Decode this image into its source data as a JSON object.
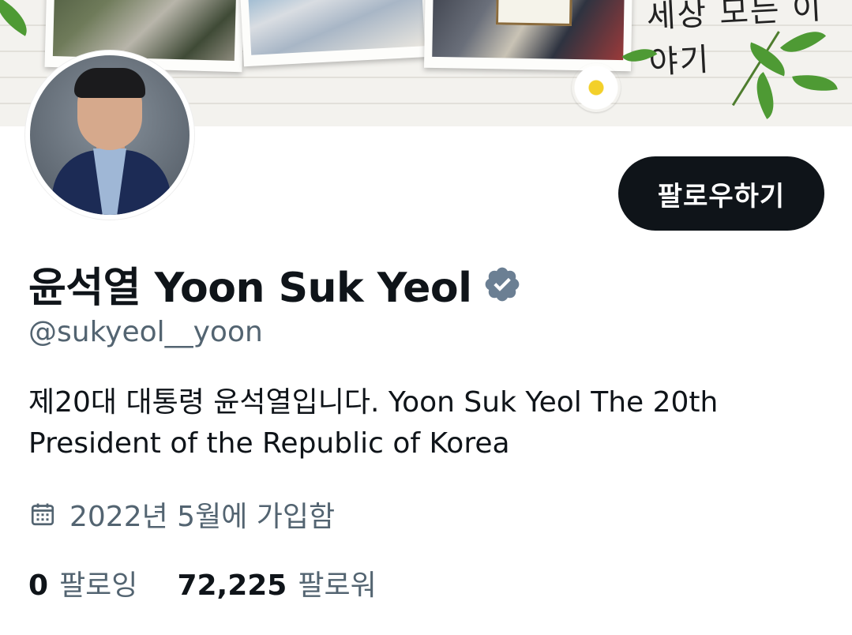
{
  "header": {
    "banner_caption": "세상 모든 이야기",
    "banner_photo_caption": ""
  },
  "profile": {
    "display_name": "윤석열 Yoon Suk Yeol",
    "handle": "@sukyeol__yoon",
    "verified_icon": "verified-badge-icon",
    "verified_color": "#6b7f93",
    "bio": "제20대 대통령 윤석열입니다. Yoon Suk Yeol The 20th President of the Republic of Korea",
    "joined": "2022년 5월에 가입함",
    "joined_icon": "calendar-icon"
  },
  "actions": {
    "follow_label": "팔로우하기",
    "follow_bg": "#0f1419"
  },
  "stats": {
    "following_count": "0",
    "following_label": "팔로잉",
    "followers_count": "72,225",
    "followers_label": "팔로워"
  },
  "colors": {
    "primary_text": "#0f1419",
    "secondary_text": "#536471"
  }
}
